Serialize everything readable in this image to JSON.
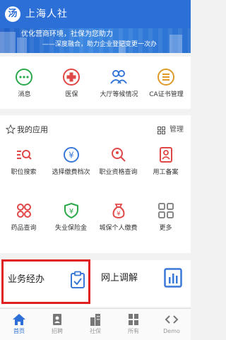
{
  "header": {
    "logo": "汤",
    "title": "上海人社"
  },
  "banner": {
    "line1": "优化营商环境，社保为您助力",
    "line2": "——深度融合，助力企业登记变更一次办"
  },
  "quick_actions": [
    {
      "label": "消息",
      "icon": "message-icon",
      "color": "#2aa84a"
    },
    {
      "label": "医保",
      "icon": "medical-cross-icon",
      "color": "#e04848"
    },
    {
      "label": "大厅等候情况",
      "icon": "people-icon",
      "color": "#3a78d8"
    },
    {
      "label": "CA证书管理",
      "icon": "certificate-icon",
      "color": "#e09a2a"
    }
  ],
  "apps": {
    "title": "我的应用",
    "manage": "管理",
    "items": [
      {
        "label": "职位搜索",
        "icon": "job-search-icon",
        "color": "#e04848"
      },
      {
        "label": "选择缴费档次",
        "icon": "yen-icon",
        "color": "#3a78d8"
      },
      {
        "label": "职业资格查询",
        "icon": "qualification-search-icon",
        "color": "#e04848"
      },
      {
        "label": "用工备案",
        "icon": "employment-record-icon",
        "color": "#e04848"
      },
      {
        "label": "药品查询",
        "icon": "drug-icon",
        "color": "#e04848"
      },
      {
        "label": "失业保险金",
        "icon": "shield-yen-icon",
        "color": "#2aa84a"
      },
      {
        "label": "城保个人缴费",
        "icon": "money-bag-icon",
        "color": "#e04848"
      },
      {
        "label": "更多",
        "icon": "more-grid-icon",
        "color": "#888888"
      }
    ]
  },
  "services": {
    "business": "业务经办",
    "mediation": "网上调解"
  },
  "tabbar": [
    {
      "label": "首页",
      "icon": "home-icon",
      "active": true
    },
    {
      "label": "招聘",
      "icon": "recruit-icon",
      "active": false
    },
    {
      "label": "社保",
      "icon": "building-icon",
      "active": false
    },
    {
      "label": "所有",
      "icon": "all-grid-icon",
      "active": false
    },
    {
      "label": "Demo",
      "icon": "code-icon",
      "active": false
    }
  ],
  "colors": {
    "primary": "#2c6fd6",
    "highlight": "#e02020"
  }
}
